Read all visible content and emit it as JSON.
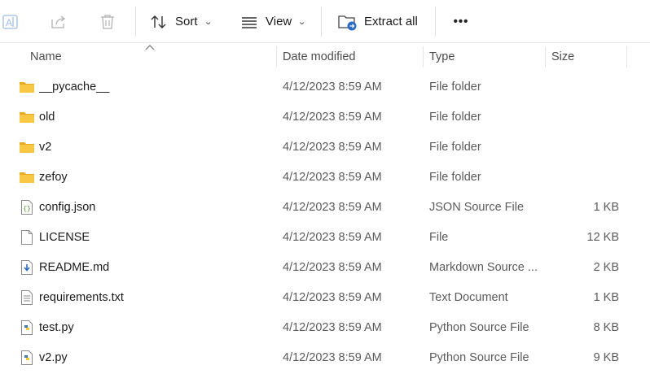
{
  "toolbar": {
    "sort_label": "Sort",
    "view_label": "View",
    "extract_label": "Extract all",
    "more_label": "•••"
  },
  "columns": {
    "name": "Name",
    "date": "Date modified",
    "type": "Type",
    "size": "Size"
  },
  "files": [
    {
      "name": "__pycache__",
      "date": "4/12/2023 8:59 AM",
      "type": "File folder",
      "size": "",
      "icon": "folder-icon"
    },
    {
      "name": "old",
      "date": "4/12/2023 8:59 AM",
      "type": "File folder",
      "size": "",
      "icon": "folder-icon"
    },
    {
      "name": "v2",
      "date": "4/12/2023 8:59 AM",
      "type": "File folder",
      "size": "",
      "icon": "folder-icon"
    },
    {
      "name": "zefoy",
      "date": "4/12/2023 8:59 AM",
      "type": "File folder",
      "size": "",
      "icon": "folder-icon"
    },
    {
      "name": "config.json",
      "date": "4/12/2023 8:59 AM",
      "type": "JSON Source File",
      "size": "1 KB",
      "icon": "json-file-icon"
    },
    {
      "name": "LICENSE",
      "date": "4/12/2023 8:59 AM",
      "type": "File",
      "size": "12 KB",
      "icon": "blank-file-icon"
    },
    {
      "name": "README.md",
      "date": "4/12/2023 8:59 AM",
      "type": "Markdown Source ...",
      "size": "2 KB",
      "icon": "markdown-file-icon"
    },
    {
      "name": "requirements.txt",
      "date": "4/12/2023 8:59 AM",
      "type": "Text Document",
      "size": "1 KB",
      "icon": "text-file-icon"
    },
    {
      "name": "test.py",
      "date": "4/12/2023 8:59 AM",
      "type": "Python Source File",
      "size": "8 KB",
      "icon": "python-file-icon"
    },
    {
      "name": "v2.py",
      "date": "4/12/2023 8:59 AM",
      "type": "Python Source File",
      "size": "9 KB",
      "icon": "python-file-icon"
    }
  ],
  "colors": {
    "folder": "#f8c743",
    "folder_dark": "#e8ab1f",
    "accent_blue": "#2b6cc4"
  }
}
